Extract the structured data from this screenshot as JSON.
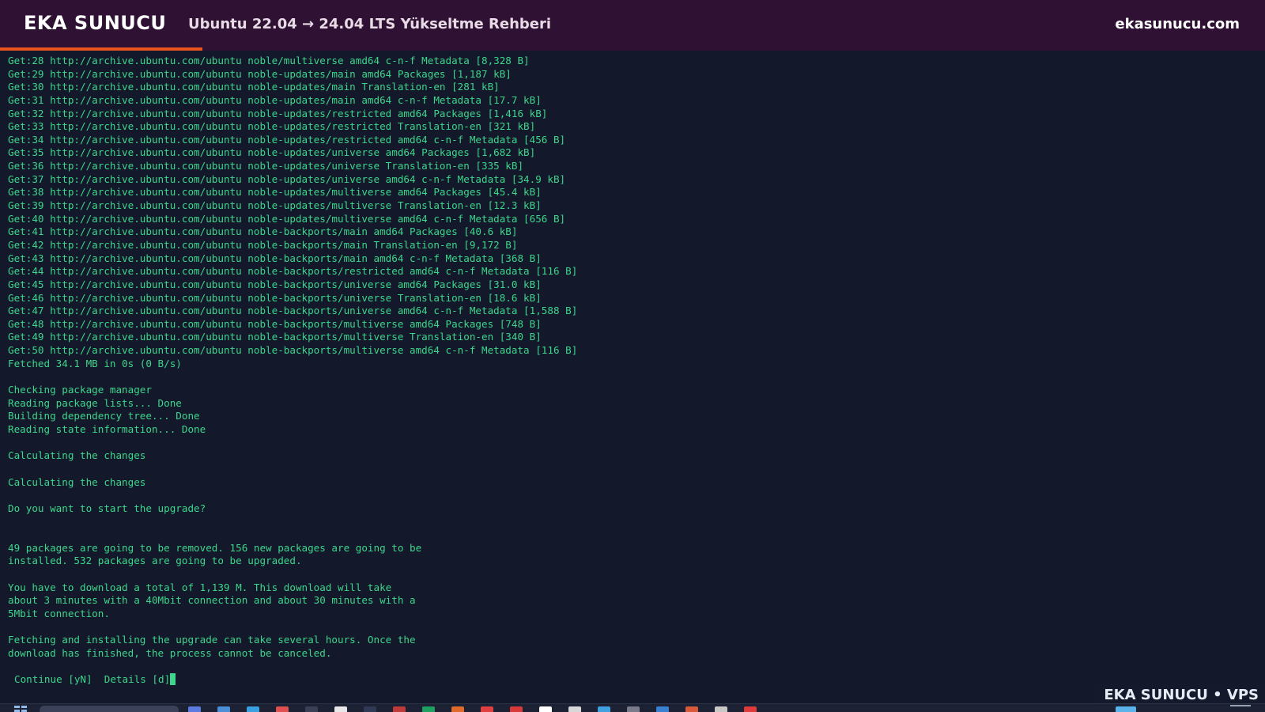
{
  "banner": {
    "brand": "EKA SUNUCU",
    "title": "Ubuntu 22.04 → 24.04 LTS Yükseltme Rehberi",
    "site": "ekasunucu.com",
    "progress": 0.16,
    "background_color": "#2f1233",
    "accent_color": "#e95420"
  },
  "terminal": {
    "text_color": "#3dd68c",
    "background_color": "#13182a",
    "lines": [
      "Get:28 http://archive.ubuntu.com/ubuntu noble/multiverse amd64 c-n-f Metadata [8,328 B]",
      "Get:29 http://archive.ubuntu.com/ubuntu noble-updates/main amd64 Packages [1,187 kB]",
      "Get:30 http://archive.ubuntu.com/ubuntu noble-updates/main Translation-en [281 kB]",
      "Get:31 http://archive.ubuntu.com/ubuntu noble-updates/main amd64 c-n-f Metadata [17.7 kB]",
      "Get:32 http://archive.ubuntu.com/ubuntu noble-updates/restricted amd64 Packages [1,416 kB]",
      "Get:33 http://archive.ubuntu.com/ubuntu noble-updates/restricted Translation-en [321 kB]",
      "Get:34 http://archive.ubuntu.com/ubuntu noble-updates/restricted amd64 c-n-f Metadata [456 B]",
      "Get:35 http://archive.ubuntu.com/ubuntu noble-updates/universe amd64 Packages [1,682 kB]",
      "Get:36 http://archive.ubuntu.com/ubuntu noble-updates/universe Translation-en [335 kB]",
      "Get:37 http://archive.ubuntu.com/ubuntu noble-updates/universe amd64 c-n-f Metadata [34.9 kB]",
      "Get:38 http://archive.ubuntu.com/ubuntu noble-updates/multiverse amd64 Packages [45.4 kB]",
      "Get:39 http://archive.ubuntu.com/ubuntu noble-updates/multiverse Translation-en [12.3 kB]",
      "Get:40 http://archive.ubuntu.com/ubuntu noble-updates/multiverse amd64 c-n-f Metadata [656 B]",
      "Get:41 http://archive.ubuntu.com/ubuntu noble-backports/main amd64 Packages [40.6 kB]",
      "Get:42 http://archive.ubuntu.com/ubuntu noble-backports/main Translation-en [9,172 B]",
      "Get:43 http://archive.ubuntu.com/ubuntu noble-backports/main amd64 c-n-f Metadata [368 B]",
      "Get:44 http://archive.ubuntu.com/ubuntu noble-backports/restricted amd64 c-n-f Metadata [116 B]",
      "Get:45 http://archive.ubuntu.com/ubuntu noble-backports/universe amd64 Packages [31.0 kB]",
      "Get:46 http://archive.ubuntu.com/ubuntu noble-backports/universe Translation-en [18.6 kB]",
      "Get:47 http://archive.ubuntu.com/ubuntu noble-backports/universe amd64 c-n-f Metadata [1,588 B]",
      "Get:48 http://archive.ubuntu.com/ubuntu noble-backports/multiverse amd64 Packages [748 B]",
      "Get:49 http://archive.ubuntu.com/ubuntu noble-backports/multiverse Translation-en [340 B]",
      "Get:50 http://archive.ubuntu.com/ubuntu noble-backports/multiverse amd64 c-n-f Metadata [116 B]",
      "Fetched 34.1 MB in 0s (0 B/s)",
      "",
      "Checking package manager",
      "Reading package lists... Done",
      "Building dependency tree... Done",
      "Reading state information... Done",
      "",
      "Calculating the changes",
      "",
      "Calculating the changes",
      "",
      "Do you want to start the upgrade?",
      "",
      "",
      "49 packages are going to be removed. 156 new packages are going to be",
      "installed. 532 packages are going to be upgraded.",
      "",
      "You have to download a total of 1,139 M. This download will take",
      "about 3 minutes with a 40Mbit connection and about 30 minutes with a",
      "5Mbit connection.",
      "",
      "Fetching and installing the upgrade can take several hours. Once the",
      "download has finished, the process cannot be canceled.",
      ""
    ],
    "prompt": {
      "continue_option": "Continue [yN]",
      "details_option": "Details [d]"
    }
  },
  "watermark": {
    "text": "EKA SUNUCU • VPS"
  },
  "taskbar": {
    "icon_colors": [
      "#5b7be0",
      "#4a8fd8",
      "#3aa0e0",
      "#e05050",
      "#3a3f55",
      "#e8e8e8",
      "#2f3a55",
      "#c03a3a",
      "#20a060",
      "#e06a2a",
      "#e04040",
      "#d83a3a",
      "#ffffff",
      "#d8d8d8",
      "#40a0e0",
      "#7a7a8a",
      "#3a80d0",
      "#d85a3a",
      "#c8c8c8",
      "#e03a3a"
    ],
    "tray_color": "#5ab4ea"
  }
}
